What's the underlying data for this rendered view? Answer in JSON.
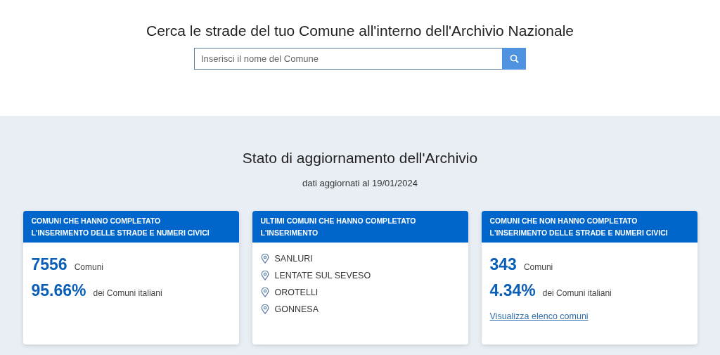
{
  "search": {
    "title": "Cerca le strade del tuo Comune all'interno dell'Archivio Nazionale",
    "placeholder": "Inserisci il nome del Comune"
  },
  "status": {
    "title": "Stato di aggiornamento dell'Archivio",
    "subtitle": "dati aggiornati al 19/01/2024",
    "cards": [
      {
        "kind": "stats",
        "title": "COMUNI CHE HANNO COMPLETATO L'INSERIMENTO DELLE STRADE E NUMERI CIVICI",
        "stats": [
          {
            "value": "7556",
            "label": "Comuni"
          },
          {
            "value": "95.66%",
            "label": "dei Comuni italiani"
          }
        ]
      },
      {
        "kind": "list",
        "title": "ULTIMI COMUNI CHE HANNO COMPLETATO L'INSERIMENTO",
        "items": [
          "SANLURI",
          "LENTATE SUL SEVESO",
          "OROTELLI",
          "GONNESA"
        ]
      },
      {
        "kind": "stats",
        "title": "COMUNI CHE NON HANNO COMPLETATO L'INSERIMENTO DELLE STRADE E NUMERI CIVICI",
        "stats": [
          {
            "value": "343",
            "label": "Comuni"
          },
          {
            "value": "4.34%",
            "label": "dei Comuni italiani"
          }
        ],
        "link": "Visualizza elenco comuni"
      }
    ]
  }
}
